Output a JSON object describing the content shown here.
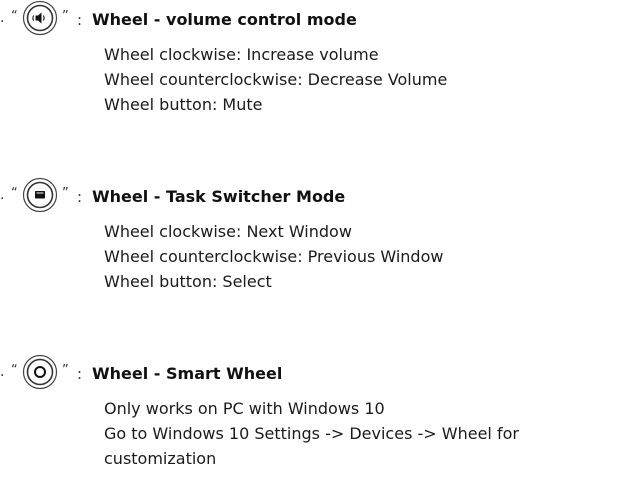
{
  "sections": [
    {
      "icon": "speaker-icon",
      "bullet": "·",
      "quote_open": "“",
      "quote_close": "”",
      "colon": ":",
      "title": "Wheel - volume control mode",
      "lines": [
        "Wheel clockwise: Increase volume",
        "Wheel counterclockwise: Decrease Volume",
        "Wheel button: Mute"
      ]
    },
    {
      "icon": "window-icon",
      "bullet": "·",
      "quote_open": "“",
      "quote_close": "”",
      "colon": ":",
      "title": "Wheel - Task Switcher Mode",
      "lines": [
        "Wheel clockwise: Next Window",
        "Wheel counterclockwise: Previous Window",
        "Wheel button: Select"
      ]
    },
    {
      "icon": "smart-wheel-icon",
      "bullet": "·",
      "quote_open": "“",
      "quote_close": "”",
      "colon": ":",
      "title": "Wheel - Smart Wheel",
      "lines": [
        "Only works on PC with Windows 10",
        "Go to Windows 10 Settings -> Devices -> Wheel for",
        "customization"
      ]
    }
  ]
}
